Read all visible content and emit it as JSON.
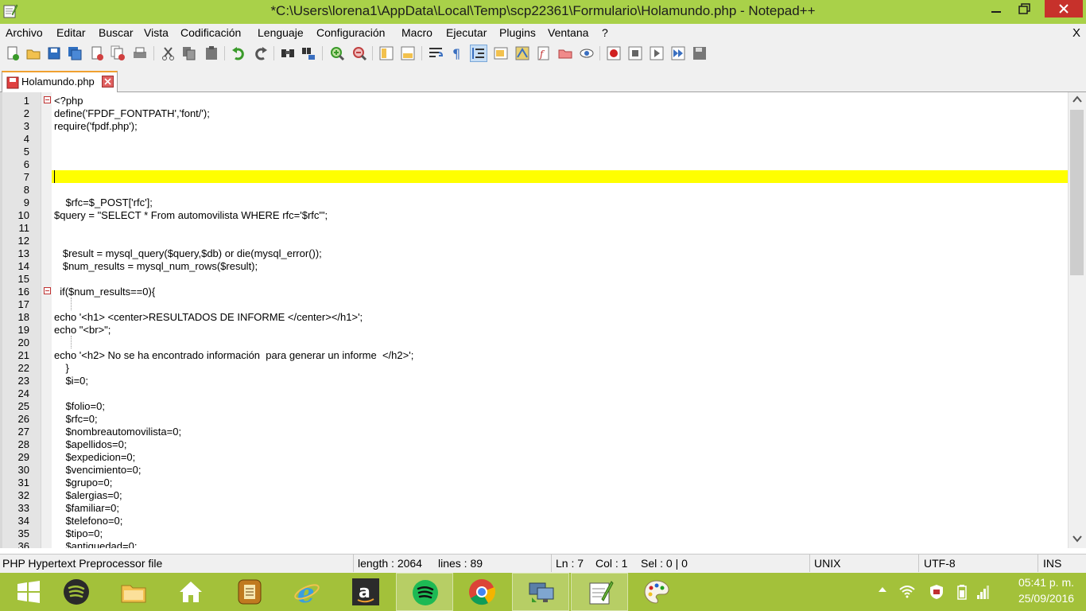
{
  "window": {
    "title": "*C:\\Users\\lorena1\\AppData\\Local\\Temp\\scp22361\\Formulario\\Holamundo.php - Notepad++"
  },
  "menu": {
    "items": [
      "Archivo",
      "Editar",
      "Buscar",
      "Vista",
      "Codificación",
      "Lenguaje",
      "Configuración",
      "Macro",
      "Ejecutar",
      "Plugins",
      "Ventana",
      "?"
    ],
    "close_label": "X"
  },
  "toolbar": {
    "icons": [
      "new-file-icon",
      "open-file-icon",
      "save-icon",
      "save-all-icon",
      "close-file-icon",
      "close-all-icon",
      "print-icon",
      "cut-icon",
      "copy-icon",
      "paste-icon",
      "undo-icon",
      "redo-icon",
      "find-icon",
      "replace-icon",
      "zoom-in-icon",
      "zoom-out-icon",
      "sync-vertical-icon",
      "sync-horizontal-icon",
      "word-wrap-icon",
      "show-all-chars-icon",
      "indent-guide-icon",
      "user-lang-icon",
      "doc-map-icon",
      "function-list-icon",
      "folder-workspace-icon",
      "monitor-icon",
      "record-macro-icon",
      "stop-record-icon",
      "play-macro-icon",
      "run-macro-multiple-icon",
      "save-macro-icon"
    ]
  },
  "tab": {
    "label": "Holamundo.php"
  },
  "editor": {
    "current_line": 7,
    "lines": [
      {
        "n": "1",
        "text": "<?php"
      },
      {
        "n": "2",
        "text": "define('FPDF_FONTPATH','font/');"
      },
      {
        "n": "3",
        "text": "require('fpdf.php');"
      },
      {
        "n": "4",
        "text": ""
      },
      {
        "n": "5",
        "text": ""
      },
      {
        "n": "6",
        "text": ""
      },
      {
        "n": "7",
        "text": ""
      },
      {
        "n": "8",
        "text": ""
      },
      {
        "n": "9",
        "text": "    $rfc=$_POST['rfc'];"
      },
      {
        "n": "10",
        "text": "$query = \"SELECT * From automovilista WHERE rfc='$rfc'\";"
      },
      {
        "n": "11",
        "text": ""
      },
      {
        "n": "12",
        "text": ""
      },
      {
        "n": "13",
        "text": "   $result = mysql_query($query,$db) or die(mysql_error());"
      },
      {
        "n": "14",
        "text": "   $num_results = mysql_num_rows($result);"
      },
      {
        "n": "15",
        "text": ""
      },
      {
        "n": "16",
        "text": "  if($num_results==0){"
      },
      {
        "n": "17",
        "text": ""
      },
      {
        "n": "18",
        "text": "echo '<h1> <center>RESULTADOS DE INFORME </center></h1>';"
      },
      {
        "n": "19",
        "text": "echo \"<br>\";"
      },
      {
        "n": "20",
        "text": ""
      },
      {
        "n": "21",
        "text": "echo '<h2> No se ha encontrado información  para generar un informe  </h2>';"
      },
      {
        "n": "22",
        "text": "    }"
      },
      {
        "n": "23",
        "text": "    $i=0;"
      },
      {
        "n": "24",
        "text": ""
      },
      {
        "n": "25",
        "text": "    $folio=0;"
      },
      {
        "n": "26",
        "text": "    $rfc=0;"
      },
      {
        "n": "27",
        "text": "    $nombreautomovilista=0;"
      },
      {
        "n": "28",
        "text": "    $apellidos=0;"
      },
      {
        "n": "29",
        "text": "    $expedicion=0;"
      },
      {
        "n": "30",
        "text": "    $vencimiento=0;"
      },
      {
        "n": "31",
        "text": "    $grupo=0;"
      },
      {
        "n": "32",
        "text": "    $alergias=0;"
      },
      {
        "n": "33",
        "text": "    $familiar=0;"
      },
      {
        "n": "34",
        "text": "    $telefono=0;"
      },
      {
        "n": "35",
        "text": "    $tipo=0;"
      },
      {
        "n": "36",
        "text": "    $antiguedad=0;"
      }
    ]
  },
  "status": {
    "file_type": "PHP Hypertext Preprocessor file",
    "length": "length : 2064",
    "lines": "lines : 89",
    "ln": "Ln : 7",
    "col": "Col : 1",
    "sel": "Sel : 0 | 0",
    "eol": "UNIX",
    "encoding": "UTF-8",
    "mode": "INS"
  },
  "taskbar": {
    "apps": [
      "windows-start",
      "spotify",
      "file-explorer",
      "home",
      "notes-app",
      "internet-explorer",
      "amazon",
      "spotify-green",
      "chrome",
      "remote-desktop",
      "notepadpp",
      "paint"
    ],
    "clock_time": "05:41 p. m.",
    "clock_date": "25/09/2016"
  },
  "colors": {
    "titlebar": "#a9d149",
    "taskbar": "#a3c13a",
    "current_line": "#ffff00",
    "close_button": "#c7312b"
  }
}
